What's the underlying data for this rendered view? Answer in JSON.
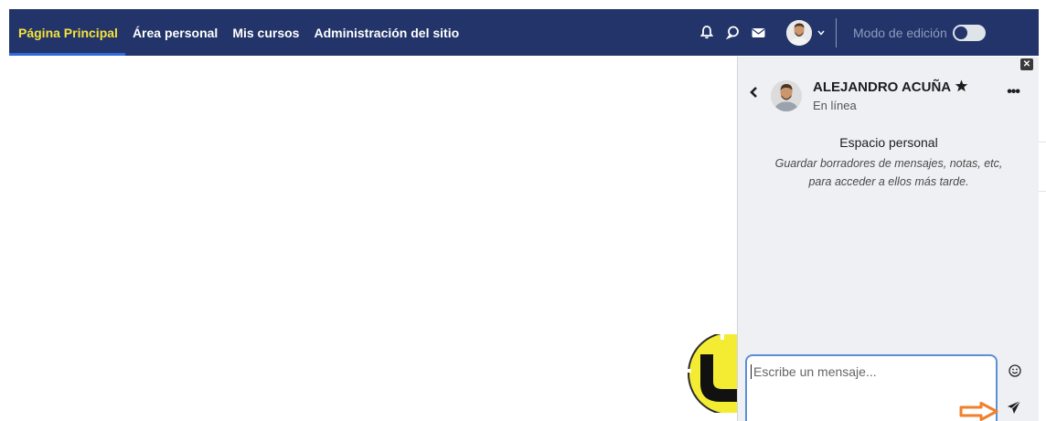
{
  "navbar": {
    "links": [
      {
        "label": "Página Principal",
        "active": true
      },
      {
        "label": "Área personal",
        "active": false
      },
      {
        "label": "Mis cursos",
        "active": false
      },
      {
        "label": "Administración del sitio",
        "active": false
      }
    ],
    "icons": [
      "bell-icon",
      "chat-bubble-icon",
      "envelope-icon"
    ],
    "edit_mode_label": "Modo de edición",
    "edit_mode_on": false,
    "colors": {
      "bar": "#22346a",
      "active_text": "#f5e33a",
      "active_underline": "#2f6ad6"
    }
  },
  "drawer": {
    "contact_name": "ALEJANDRO ACUÑA",
    "contact_status": "En línea",
    "starred": true,
    "space_title": "Espacio personal",
    "space_description": "Guardar borradores de mensajes, notas, etc, para acceder a ellos más tarde.",
    "composer_placeholder": "Escribe un mensaje...",
    "icons": [
      "close-icon",
      "back-chevron-icon",
      "star-icon",
      "more-icon",
      "emoji-icon",
      "send-icon"
    ]
  },
  "overlays": {
    "logo_letter": "U",
    "logo_color": "#f4ec33",
    "arrow_color": "#f0802c"
  }
}
